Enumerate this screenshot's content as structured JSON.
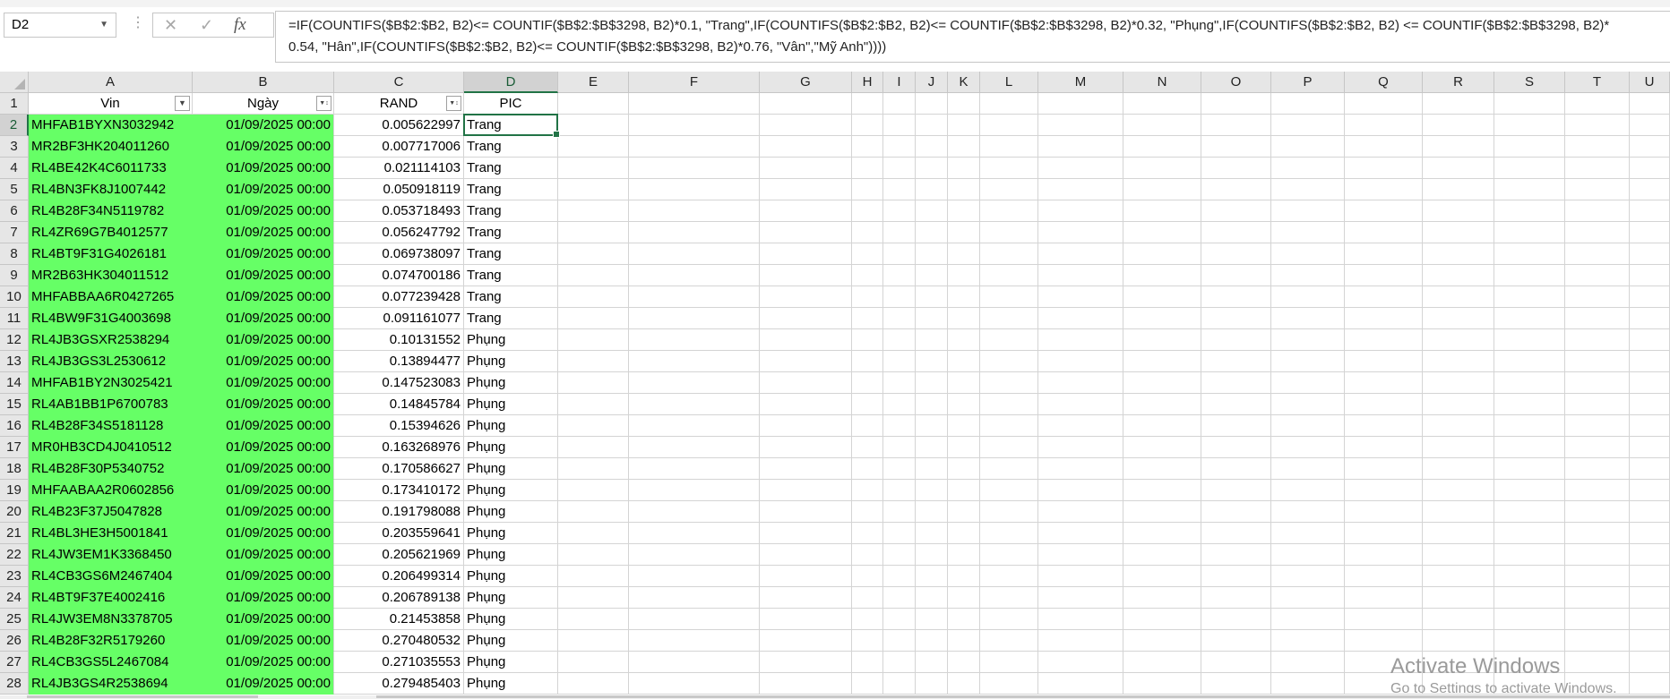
{
  "namebox": {
    "value": "D2",
    "dropdown_icon": "chevron-down-icon"
  },
  "formula_bar": {
    "more_icon": "more-vertical-icon",
    "cancel_icon": "close-icon",
    "enter_icon": "check-icon",
    "fx_label": "fx",
    "line1": "=IF(COUNTIFS($B$2:$B2, B2)<= COUNTIF($B$2:$B$3298, B2)*0.1, \"Trang\",IF(COUNTIFS($B$2:$B2, B2)<= COUNTIF($B$2:$B$3298, B2)*0.32, \"Phụng\",IF(COUNTIFS($B$2:$B2, B2) <= COUNTIF($B$2:$B$3298, B2)*",
    "line2": "0.54, \"Hân\",IF(COUNTIFS($B$2:$B2, B2)<= COUNTIF($B$2:$B$3298, B2)*0.76, \"Vân\",\"Mỹ Anh\"))))"
  },
  "columns": [
    "A",
    "B",
    "C",
    "D",
    "E",
    "F",
    "G",
    "H",
    "I",
    "J",
    "K",
    "L",
    "M",
    "N",
    "O",
    "P",
    "Q",
    "R",
    "S",
    "T",
    "U"
  ],
  "header_row": {
    "number": "1",
    "A": "Vin",
    "B": "Ngày",
    "C": "RAND",
    "D": "PIC"
  },
  "rows": [
    {
      "n": "2",
      "vin": "MHFAB1BYXN3032942",
      "date": "01/09/2025 00:00",
      "rand": "0.005622997",
      "pic": "Trang"
    },
    {
      "n": "3",
      "vin": "MR2BF3HK204011260",
      "date": "01/09/2025 00:00",
      "rand": "0.007717006",
      "pic": "Trang"
    },
    {
      "n": "4",
      "vin": "RL4BE42K4C6011733",
      "date": "01/09/2025 00:00",
      "rand": "0.021114103",
      "pic": "Trang"
    },
    {
      "n": "5",
      "vin": "RL4BN3FK8J1007442",
      "date": "01/09/2025 00:00",
      "rand": "0.050918119",
      "pic": "Trang"
    },
    {
      "n": "6",
      "vin": "RL4B28F34N5119782",
      "date": "01/09/2025 00:00",
      "rand": "0.053718493",
      "pic": "Trang"
    },
    {
      "n": "7",
      "vin": "RL4ZR69G7B4012577",
      "date": "01/09/2025 00:00",
      "rand": "0.056247792",
      "pic": "Trang"
    },
    {
      "n": "8",
      "vin": "RL4BT9F31G4026181",
      "date": "01/09/2025 00:00",
      "rand": "0.069738097",
      "pic": "Trang"
    },
    {
      "n": "9",
      "vin": "MR2B63HK304011512",
      "date": "01/09/2025 00:00",
      "rand": "0.074700186",
      "pic": "Trang"
    },
    {
      "n": "10",
      "vin": "MHFABBAA6R0427265",
      "date": "01/09/2025 00:00",
      "rand": "0.077239428",
      "pic": "Trang"
    },
    {
      "n": "11",
      "vin": "RL4BW9F31G4003698",
      "date": "01/09/2025 00:00",
      "rand": "0.091161077",
      "pic": "Trang"
    },
    {
      "n": "12",
      "vin": "RL4JB3GSXR2538294",
      "date": "01/09/2025 00:00",
      "rand": "0.10131552",
      "pic": "Phụng"
    },
    {
      "n": "13",
      "vin": "RL4JB3GS3L2530612",
      "date": "01/09/2025 00:00",
      "rand": "0.13894477",
      "pic": "Phụng"
    },
    {
      "n": "14",
      "vin": "MHFAB1BY2N3025421",
      "date": "01/09/2025 00:00",
      "rand": "0.147523083",
      "pic": "Phụng"
    },
    {
      "n": "15",
      "vin": "RL4AB1BB1P6700783",
      "date": "01/09/2025 00:00",
      "rand": "0.14845784",
      "pic": "Phụng"
    },
    {
      "n": "16",
      "vin": "RL4B28F34S5181128",
      "date": "01/09/2025 00:00",
      "rand": "0.15394626",
      "pic": "Phụng"
    },
    {
      "n": "17",
      "vin": "MR0HB3CD4J0410512",
      "date": "01/09/2025 00:00",
      "rand": "0.163268976",
      "pic": "Phụng"
    },
    {
      "n": "18",
      "vin": "RL4B28F30P5340752",
      "date": "01/09/2025 00:00",
      "rand": "0.170586627",
      "pic": "Phụng"
    },
    {
      "n": "19",
      "vin": "MHFAABAA2R0602856",
      "date": "01/09/2025 00:00",
      "rand": "0.173410172",
      "pic": "Phụng"
    },
    {
      "n": "20",
      "vin": "RL4B23F37J5047828",
      "date": "01/09/2025 00:00",
      "rand": "0.191798088",
      "pic": "Phụng"
    },
    {
      "n": "21",
      "vin": "RL4BL3HE3H5001841",
      "date": "01/09/2025 00:00",
      "rand": "0.203559641",
      "pic": "Phụng"
    },
    {
      "n": "22",
      "vin": "RL4JW3EM1K3368450",
      "date": "01/09/2025 00:00",
      "rand": "0.205621969",
      "pic": "Phụng"
    },
    {
      "n": "23",
      "vin": "RL4CB3GS6M2467404",
      "date": "01/09/2025 00:00",
      "rand": "0.206499314",
      "pic": "Phụng"
    },
    {
      "n": "24",
      "vin": "RL4BT9F37E4002416",
      "date": "01/09/2025 00:00",
      "rand": "0.206789138",
      "pic": "Phụng"
    },
    {
      "n": "25",
      "vin": "RL4JW3EM8N3378705",
      "date": "01/09/2025 00:00",
      "rand": "0.21453858",
      "pic": "Phụng"
    },
    {
      "n": "26",
      "vin": "RL4B28F32R5179260",
      "date": "01/09/2025 00:00",
      "rand": "0.270480532",
      "pic": "Phụng"
    },
    {
      "n": "27",
      "vin": "RL4CB3GS5L2467084",
      "date": "01/09/2025 00:00",
      "rand": "0.271035553",
      "pic": "Phụng"
    },
    {
      "n": "28",
      "vin": "RL4JB3GS4R2538694",
      "date": "01/09/2025 00:00",
      "rand": "0.279485403",
      "pic": "Phụng"
    }
  ],
  "watermark": {
    "line1": "Activate Windows",
    "line2": "Go to Settings to activate Windows."
  },
  "colors": {
    "highlight_fill": "#66ff66",
    "selection": "#217346",
    "header_bg": "#e6e6e6"
  }
}
